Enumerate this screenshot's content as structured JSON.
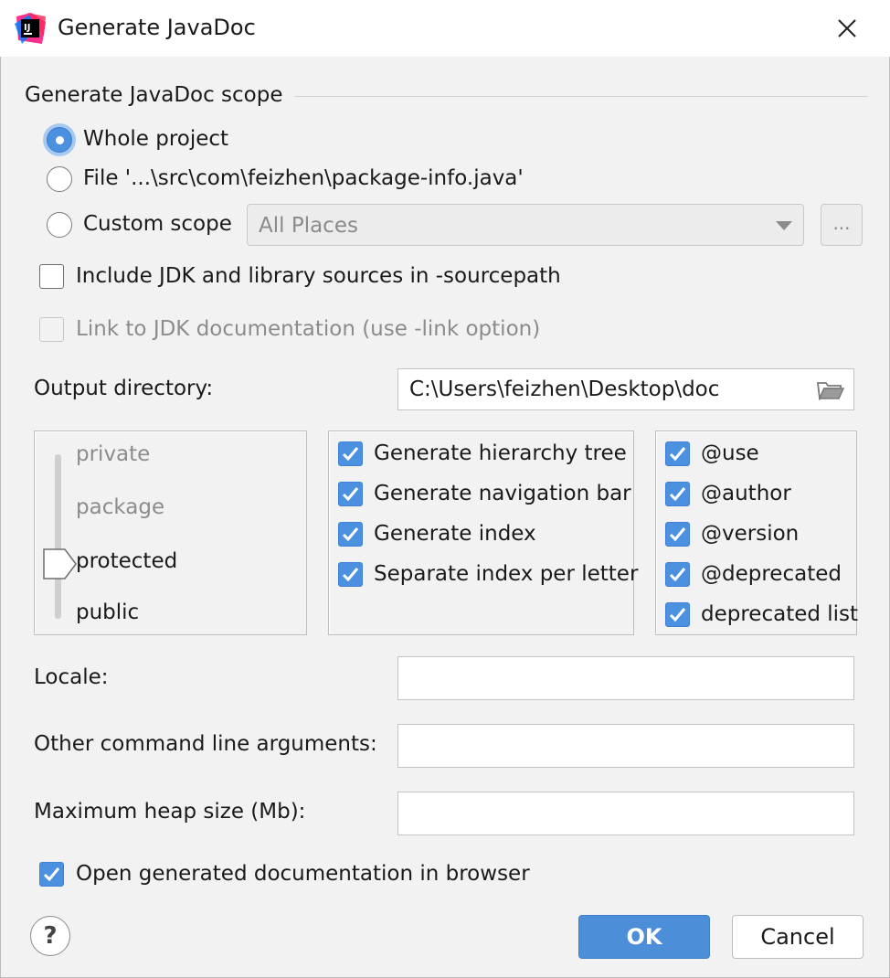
{
  "window": {
    "title": "Generate JavaDoc",
    "close_icon": "close-icon"
  },
  "scope": {
    "title": "Generate JavaDoc scope",
    "options": [
      {
        "label": "Whole project",
        "selected": true
      },
      {
        "label": "File '...\\src\\com\\feizhen\\package-info.java'",
        "selected": false
      },
      {
        "label": "Custom scope",
        "selected": false
      }
    ],
    "custom_scope_value": "All Places",
    "browse_label": "..."
  },
  "options": {
    "include_jdk": {
      "label": "Include JDK and library sources in -sourcepath",
      "checked": false
    },
    "link_jdk": {
      "label": "Link to JDK documentation (use -link option)",
      "checked": false,
      "disabled": true
    }
  },
  "output": {
    "label": "Output directory:",
    "value": "C:\\Users\\feizhen\\Desktop\\doc"
  },
  "visibility": {
    "levels": [
      "private",
      "package",
      "protected",
      "public"
    ],
    "selected": "protected"
  },
  "generate": [
    {
      "label": "Generate hierarchy tree",
      "checked": true
    },
    {
      "label": "Generate navigation bar",
      "checked": true
    },
    {
      "label": "Generate index",
      "checked": true
    },
    {
      "label": "Separate index per letter",
      "checked": true
    }
  ],
  "tags": [
    {
      "label": "@use",
      "checked": true
    },
    {
      "label": "@author",
      "checked": true
    },
    {
      "label": "@version",
      "checked": true
    },
    {
      "label": "@deprecated",
      "checked": true
    },
    {
      "label": "deprecated list",
      "checked": true
    }
  ],
  "locale": {
    "label": "Locale:",
    "value": ""
  },
  "other_args": {
    "label": "Other command line arguments:",
    "value": ""
  },
  "heap": {
    "label": "Maximum heap size (Mb):",
    "value": ""
  },
  "open_browser": {
    "label": "Open generated documentation in browser",
    "checked": true
  },
  "buttons": {
    "ok": "OK",
    "cancel": "Cancel",
    "help": "?"
  },
  "colors": {
    "accent": "#4c90e0",
    "background": "#f2f2f2"
  }
}
